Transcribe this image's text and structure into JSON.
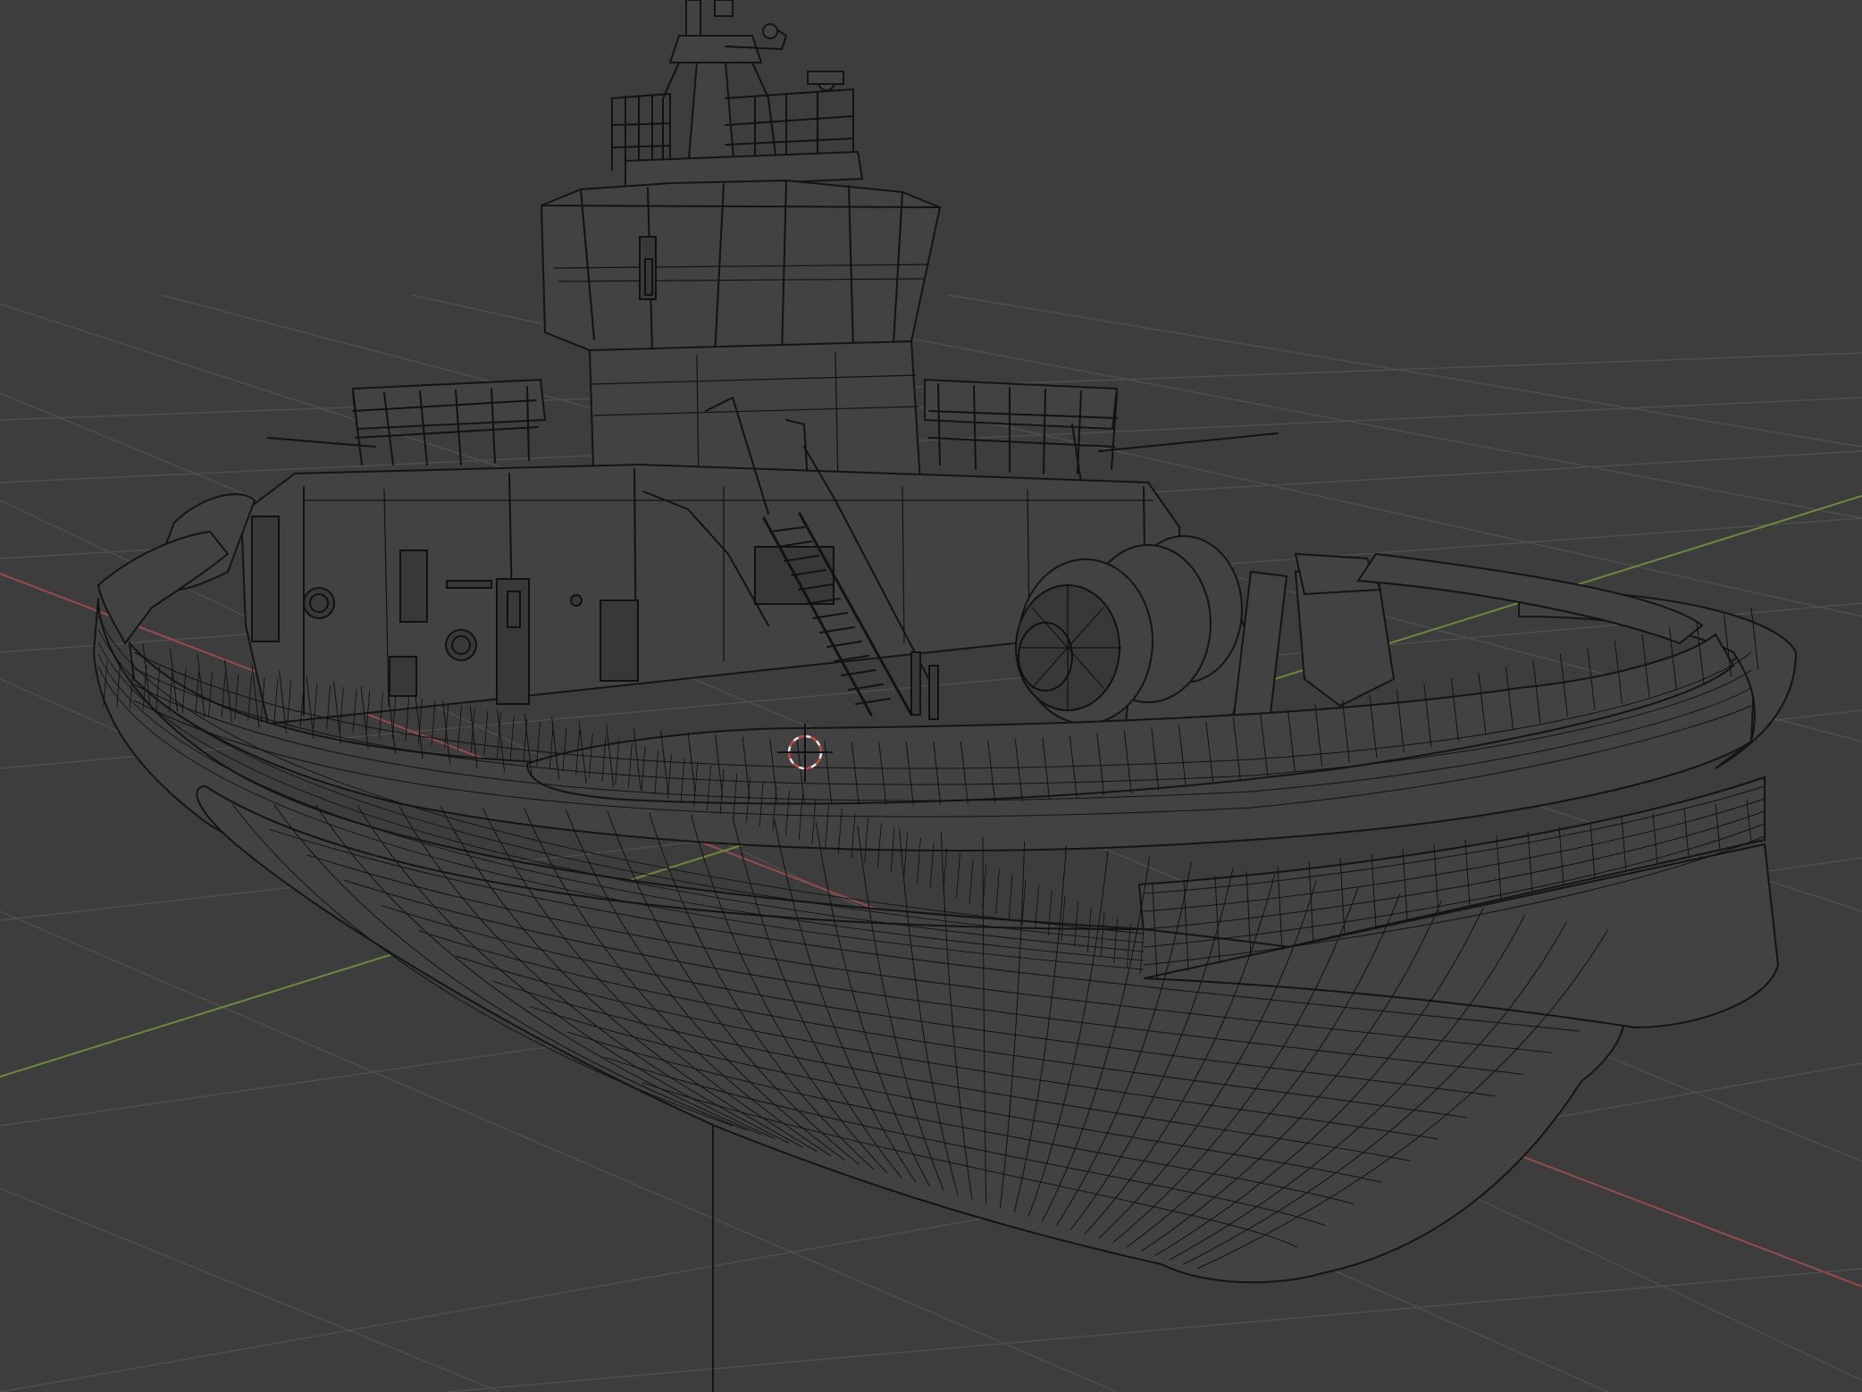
{
  "viewport": {
    "mode": "wireframe",
    "colors": {
      "background": "#3d3d3d",
      "grid": "#4f4f4f",
      "x_axis": "#9a4a4a",
      "y_axis": "#6b8a3a",
      "wire": "#121212",
      "origin": "#e8a040",
      "cursor_red": "#c84a3a"
    },
    "object": "tugboat",
    "cursor": "3d-cursor-icon",
    "origin": "object-origin-dot"
  }
}
